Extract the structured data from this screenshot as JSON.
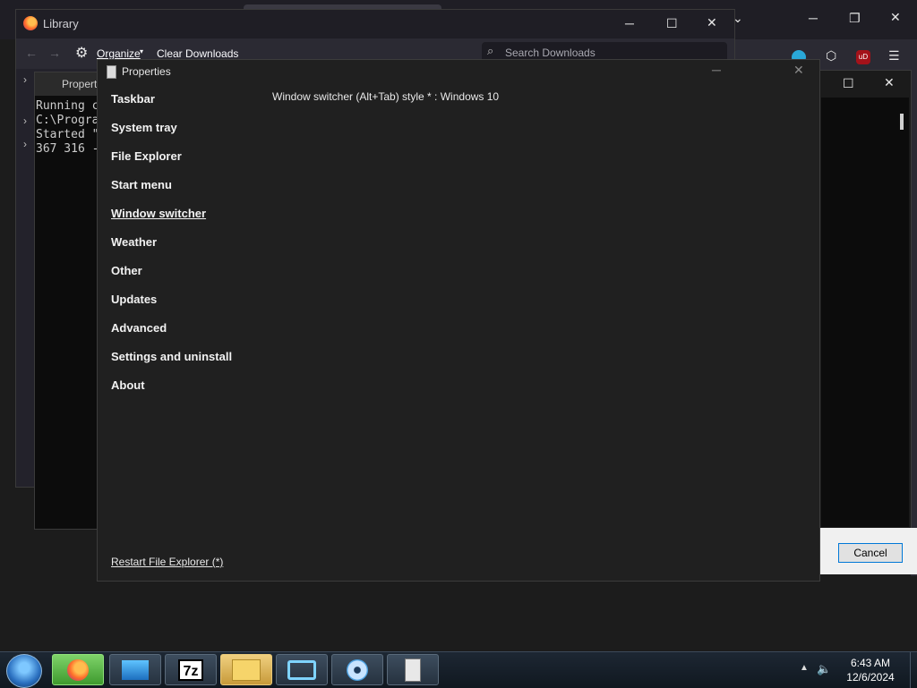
{
  "library": {
    "title": "Library",
    "toolbar": {
      "organize": "Organize",
      "organize_caret": "▾",
      "clear_downloads": "Clear Downloads"
    },
    "search_placeholder": "Search Downloads"
  },
  "console": {
    "title": "Propert",
    "lines": [
      "Running c",
      "C:\\Progra",
      "Started \"",
      "367 316 -"
    ]
  },
  "properties": {
    "title": "Properties",
    "nav": [
      {
        "label": "Taskbar"
      },
      {
        "label": "System tray"
      },
      {
        "label": "File Explorer"
      },
      {
        "label": "Start menu"
      },
      {
        "label": "Window switcher"
      },
      {
        "label": "Weather"
      },
      {
        "label": "Other"
      },
      {
        "label": "Updates"
      },
      {
        "label": "Advanced"
      },
      {
        "label": "Settings and uninstall"
      },
      {
        "label": "About"
      }
    ],
    "active_item": "Window switcher",
    "setting": "Window switcher (Alt+Tab) style * : Windows 10",
    "restart_link": "Restart File Explorer (*)"
  },
  "dialog_back": {
    "cancel": "Cancel"
  },
  "taskbar": {
    "apps": [
      {
        "name": "firefox"
      },
      {
        "name": "photos"
      },
      {
        "name": "7-zip",
        "label": "7z"
      },
      {
        "name": "file-explorer"
      },
      {
        "name": "app-blue"
      },
      {
        "name": "disc-app"
      },
      {
        "name": "properties-app"
      }
    ],
    "clock": {
      "time": "6:43 AM",
      "date": "12/6/2024"
    }
  },
  "colors": {
    "accent": "#0078d7",
    "window_bg": "#202020",
    "taskbar": "#1d2733"
  }
}
